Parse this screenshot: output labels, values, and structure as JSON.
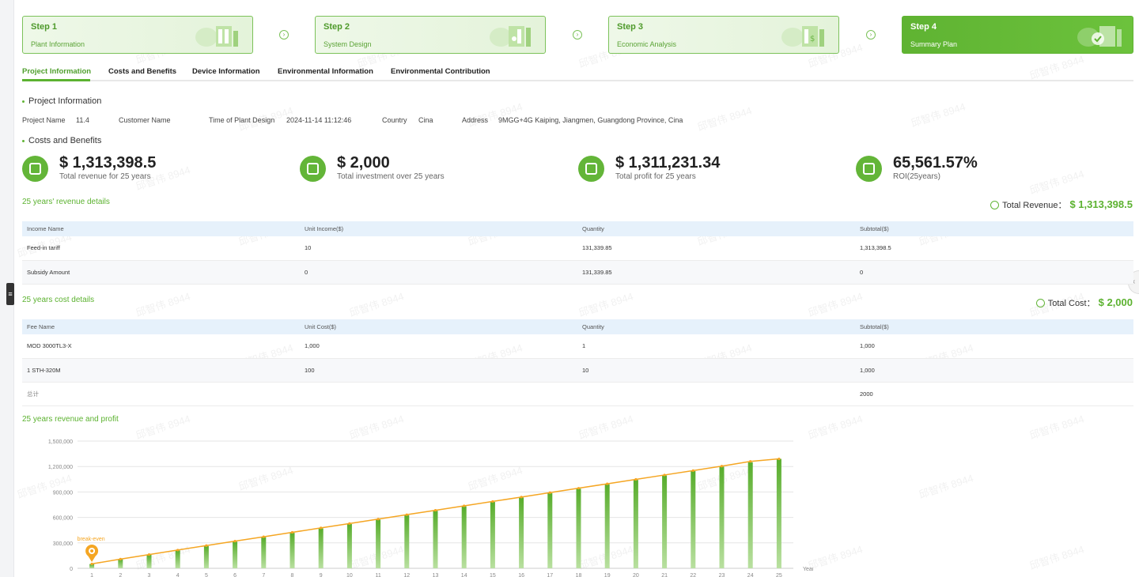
{
  "steps": [
    {
      "num": "Step 1",
      "name": "Plant Information",
      "active": false
    },
    {
      "num": "Step 2",
      "name": "System Design",
      "active": false
    },
    {
      "num": "Step 3",
      "name": "Economic Analysis",
      "active": false
    },
    {
      "num": "Step 4",
      "name": "Summary Plan",
      "active": true
    }
  ],
  "tabs": [
    "Project Information",
    "Costs and Benefits",
    "Device Information",
    "Environmental Information",
    "Environmental Contribution"
  ],
  "active_tab": "Project Information",
  "project": {
    "section_title": "Project Information",
    "name_label": "Project Name",
    "name_value": "11.4",
    "customer_label": "Customer Name",
    "customer_value": "",
    "time_label": "Time of Plant Design",
    "time_value": "2024-11-14 11:12:46",
    "country_label": "Country",
    "country_value": "Cina",
    "address_label": "Address",
    "address_value": "9MGG+4G Kaiping, Jiangmen, Guangdong Province, Cina"
  },
  "costs": {
    "section_title": "Costs and Benefits",
    "metrics": [
      {
        "value": "$ 1,313,398.5",
        "label": "Total revenue for 25 years",
        "icon": "calculator-icon"
      },
      {
        "value": "$ 2,000",
        "label": "Total investment over 25 years",
        "icon": "investment-icon"
      },
      {
        "value": "$ 1,311,231.34",
        "label": "Total profit for 25 years",
        "icon": "profit-chart-icon"
      },
      {
        "value": "65,561.57%",
        "label": "ROI(25years)",
        "icon": "roi-icon"
      }
    ]
  },
  "revenue": {
    "title": "25 years' revenue details",
    "total_label": "Total Revenue：",
    "total_value": "$ 1,313,398.5",
    "headers": [
      "Income Name",
      "Unit Income($)",
      "Quantity",
      "Subtotal($)"
    ],
    "rows": [
      [
        "Feed-in tariff",
        "10",
        "131,339.85",
        "1,313,398.5"
      ],
      [
        "Subsidy Amount",
        "0",
        "131,339.85",
        "0"
      ]
    ]
  },
  "cost": {
    "title": "25 years cost details",
    "total_label": "Total Cost：",
    "total_value": "$ 2,000",
    "headers": [
      "Fee Name",
      "Unit Cost($)",
      "Quantity",
      "Subtotal($)"
    ],
    "rows": [
      [
        "MOD 3000TL3-X",
        "1,000",
        "1",
        "1,000"
      ],
      [
        "1 STH-320M",
        "100",
        "10",
        "1,000"
      ],
      [
        "总计",
        "",
        "",
        "2000"
      ]
    ]
  },
  "watermark_text": "邱智伟 8944",
  "chart_data": {
    "type": "bar",
    "title": "25 years revenue and profit",
    "xlabel": "Year",
    "ylabel": "",
    "ylim": [
      0,
      1500000
    ],
    "yticks": [
      "1,500,000",
      "1,200,000",
      "900,000",
      "600,000",
      "300,000",
      "0"
    ],
    "categories": [
      "1",
      "2",
      "3",
      "4",
      "5",
      "6",
      "7",
      "8",
      "9",
      "10",
      "11",
      "12",
      "13",
      "14",
      "15",
      "16",
      "17",
      "18",
      "19",
      "20",
      "21",
      "22",
      "23",
      "24",
      "25"
    ],
    "series": [
      {
        "type": "bar",
        "values": [
          50000,
          105000,
          158000,
          210000,
          262000,
          314000,
          366000,
          418000,
          470000,
          522000,
          574000,
          626000,
          678000,
          730000,
          782000,
          834000,
          886000,
          938000,
          990000,
          1042000,
          1094000,
          1146000,
          1198000,
          1250000,
          1290000
        ]
      },
      {
        "type": "line",
        "values": [
          52000,
          108000,
          162000,
          215000,
          268000,
          320000,
          372000,
          424000,
          476000,
          528000,
          580000,
          632000,
          684000,
          736000,
          788000,
          840000,
          892000,
          944000,
          996000,
          1048000,
          1100000,
          1152000,
          1204000,
          1260000,
          1290000
        ]
      }
    ],
    "annotation": {
      "label": "break-even",
      "x": "1"
    },
    "colors": {
      "bar": "#5fb332",
      "line": "#f5a623",
      "grid": "#e5e5e5"
    }
  }
}
